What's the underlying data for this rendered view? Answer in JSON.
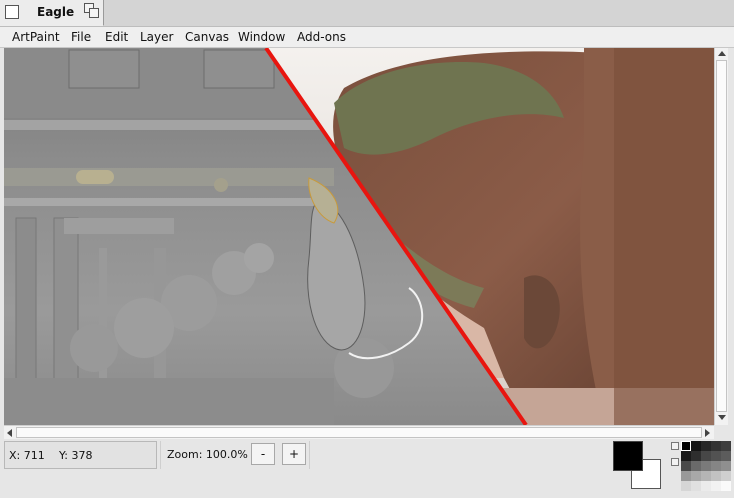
{
  "window": {
    "tab_title": "Eagle"
  },
  "menu": {
    "items": [
      "ArtPaint",
      "File",
      "Edit",
      "Layer",
      "Canvas",
      "Window",
      "Add-ons"
    ]
  },
  "status": {
    "x_label": "X: 711",
    "y_label": "Y: 378",
    "zoom_label": "Zoom: 100.0%",
    "zoom_out": "-",
    "zoom_in": "+"
  },
  "colors": {
    "foreground": "#000000",
    "background": "#ffffff",
    "divider_line": "#e8150f"
  },
  "icons": {
    "tab_close": "close-box-icon",
    "tab_detach": "detach-icon"
  }
}
